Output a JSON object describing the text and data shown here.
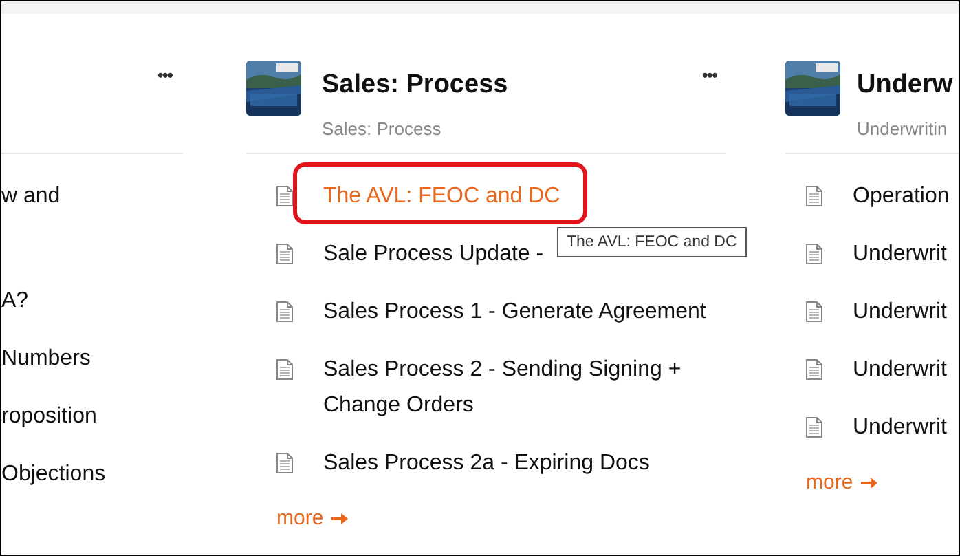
{
  "columns": [
    {
      "menu": "•••",
      "items": [
        {
          "text": "w and",
          "hovered": false,
          "annotated": false
        },
        {
          "text": "A?",
          "hovered": false,
          "annotated": false
        },
        {
          "text": "Numbers",
          "hovered": false,
          "annotated": false
        },
        {
          "text": "roposition",
          "hovered": false,
          "annotated": false
        },
        {
          "text": "Objections",
          "hovered": false,
          "annotated": false
        }
      ]
    },
    {
      "title": "Sales: Process",
      "subtitle": "Sales: Process",
      "menu": "•••",
      "items": [
        {
          "text": "The AVL: FEOC and DC",
          "hovered": true,
          "annotated": true,
          "tooltip": "The AVL: FEOC and DC"
        },
        {
          "text": "Sale Process Update -",
          "hovered": false,
          "annotated": false
        },
        {
          "text": "Sales Process 1 - Generate Agreement",
          "hovered": false,
          "annotated": false
        },
        {
          "text": "Sales Process 2 - Sending Signing + Change Orders",
          "hovered": false,
          "annotated": false
        },
        {
          "text": "Sales Process 2a - Expiring Docs",
          "hovered": false,
          "annotated": false
        }
      ],
      "more": "more"
    },
    {
      "title": "Underw",
      "subtitle": "Underwritin",
      "items": [
        {
          "text": "Operation",
          "hovered": false,
          "annotated": false
        },
        {
          "text": "Underwrit",
          "hovered": false,
          "annotated": false
        },
        {
          "text": "Underwrit",
          "hovered": false,
          "annotated": false
        },
        {
          "text": "Underwrit",
          "hovered": false,
          "annotated": false
        },
        {
          "text": "Underwrit",
          "hovered": false,
          "annotated": false
        }
      ],
      "more": "more"
    }
  ]
}
